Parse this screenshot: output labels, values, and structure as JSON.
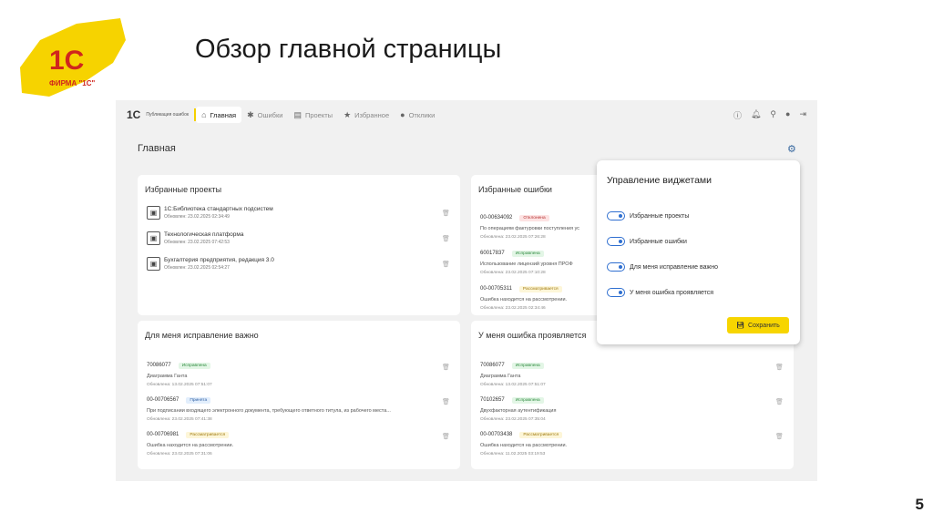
{
  "slide": {
    "title": "Обзор главной страницы",
    "page_number": "5",
    "logo_text": "ФИРМА \"1С\""
  },
  "nav": {
    "brand": "1С",
    "app_name": "Публикация ошибок",
    "items": [
      "Главная",
      "Ошибки",
      "Проекты",
      "Избранное",
      "Отклики"
    ]
  },
  "page_title": "Главная",
  "fav_projects": {
    "title": "Избранные проекты",
    "items": [
      {
        "name": "1С:Библиотека стандартных подсистем",
        "updated": "Обновлен: 23.02.2025 02:34:49"
      },
      {
        "name": "Технологическая платформа",
        "updated": "Обновлен: 23.02.2025 07:42:53"
      },
      {
        "name": "Бухгалтерия предприятия, редакция 3.0",
        "updated": "Обновлен: 23.02.2025 02:54:27"
      }
    ]
  },
  "fav_errors": {
    "title": "Избранные ошибки",
    "items": [
      {
        "id": "00-00634092",
        "status": "Отклонена",
        "desc": "По операциям фактуровки поступления ус",
        "updated": "Обновлена: 23.02.2025 07:26:28"
      },
      {
        "id": "60017837",
        "status": "Исправлена",
        "desc": "Использование лицензий уровня ПРОФ",
        "updated": "Обновлена: 23.02.2025 07:10:28"
      },
      {
        "id": "00-00705311",
        "status": "Рассматривается",
        "desc": "Ошибка находится на рассмотрении.",
        "updated": "Обновлена: 23.02.2025 02:34:46"
      }
    ]
  },
  "important": {
    "title": "Для меня исправление важно",
    "items": [
      {
        "id": "70086077",
        "status": "Исправлена",
        "desc": "Диаграмма Ганта",
        "updated": "Обновлена: 13.02.2025 07:51:07"
      },
      {
        "id": "00-00706567",
        "status": "Принята",
        "desc": "При подписании входящего электронного документа, требующего ответного титула, из рабочего места...",
        "updated": "Обновлена: 23.02.2025 07:41:38"
      },
      {
        "id": "00-00706981",
        "status": "Рассматривается",
        "desc": "Ошибка находится на рассмотрении.",
        "updated": "Обновлена: 23.02.2025 07:31:06"
      }
    ]
  },
  "occurs": {
    "title": "У меня ошибка проявляется",
    "items": [
      {
        "id": "70086077",
        "status": "Исправлена",
        "desc": "Диаграмма Ганта",
        "updated": "Обновлена: 13.02.2025 07:51:07"
      },
      {
        "id": "70102657",
        "status": "Исправлена",
        "desc": "Двухфакторная аутентификация",
        "updated": "Обновлена: 23.02.2025 07:35:04"
      },
      {
        "id": "00-00703438",
        "status": "Рассматривается",
        "desc": "Ошибка находится на рассмотрении.",
        "updated": "Обновлена: 11.02.2025 03:19:53"
      }
    ]
  },
  "widgets": {
    "title": "Управление виджетами",
    "toggles": [
      "Избранные проекты",
      "Избранные ошибки",
      "Для меня исправление важно",
      "У меня ошибка проявляется"
    ],
    "save_label": "Сохранить"
  }
}
